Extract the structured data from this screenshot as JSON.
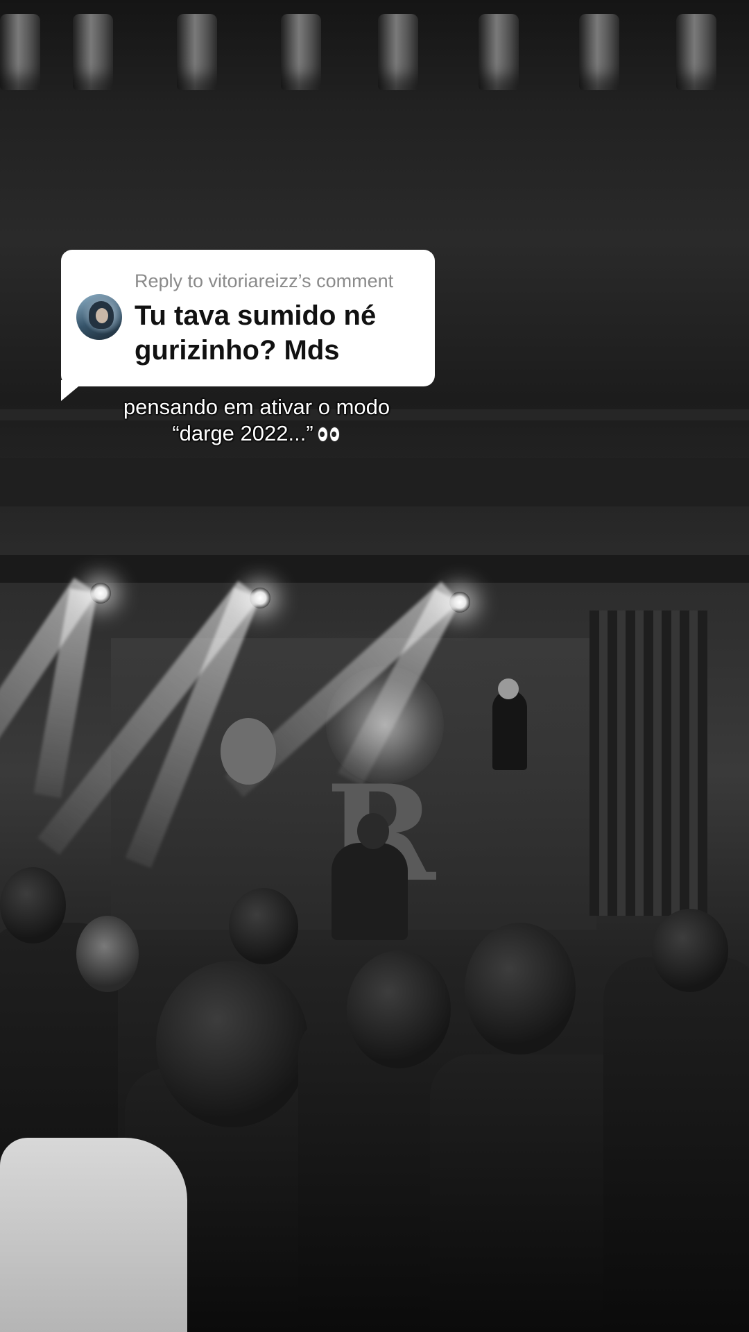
{
  "reply": {
    "label": "Reply to vitoriareizz’s comment",
    "text": "Tu tava sumido né gurizinho? Mds"
  },
  "caption": {
    "line1": "pensando em ativar o modo",
    "line2": "“darge 2022...”",
    "emoji": "eyes-emoji"
  },
  "scene": {
    "stage_letters": "R",
    "style": "black-and-white concert photo"
  }
}
